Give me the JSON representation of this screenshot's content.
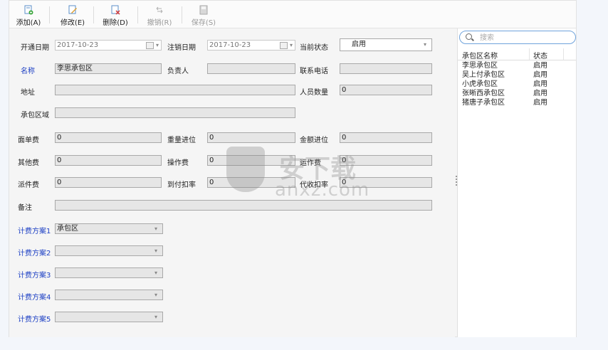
{
  "toolbar": {
    "add": "添加(A)",
    "edit": "修改(E)",
    "delete": "删除(D)",
    "undo": "撤销(R)",
    "save": "保存(S)"
  },
  "form": {
    "open_date": {
      "label": "开通日期",
      "value": "2017-10-23"
    },
    "cancel_date": {
      "label": "注销日期",
      "value": "2017-10-23"
    },
    "status": {
      "label": "当前状态",
      "value": "启用"
    },
    "name": {
      "label": "名称",
      "value": "李思承包区"
    },
    "manager": {
      "label": "负责人",
      "value": ""
    },
    "phone": {
      "label": "联系电话",
      "value": ""
    },
    "address": {
      "label": "地址",
      "value": ""
    },
    "staff_count": {
      "label": "人员数量",
      "value": "0"
    },
    "region": {
      "label": "承包区域",
      "value": ""
    },
    "sheet_fee": {
      "label": "面单费",
      "value": "0"
    },
    "weight_round": {
      "label": "重量进位",
      "value": "0"
    },
    "amount_round": {
      "label": "金额进位",
      "value": "0"
    },
    "other_fee": {
      "label": "其他费",
      "value": "0"
    },
    "operation_fee": {
      "label": "操作费",
      "value": "0"
    },
    "freight": {
      "label": "运作费",
      "value": "0"
    },
    "delivery_fee": {
      "label": "派件费",
      "value": "0"
    },
    "cod_deduct": {
      "label": "到付扣率",
      "value": "0"
    },
    "collect_deduct": {
      "label": "代收扣率",
      "value": "0"
    },
    "remark": {
      "label": "备注",
      "value": ""
    },
    "plans": [
      {
        "label": "计费方案1",
        "value": "承包区"
      },
      {
        "label": "计费方案2",
        "value": ""
      },
      {
        "label": "计费方案3",
        "value": ""
      },
      {
        "label": "计费方案4",
        "value": ""
      },
      {
        "label": "计费方案5",
        "value": ""
      }
    ]
  },
  "list": {
    "search_placeholder": "搜索",
    "col_name": "承包区名称",
    "col_status": "状态",
    "rows": [
      {
        "name": "李思承包区",
        "status": "启用"
      },
      {
        "name": "吴上付承包区",
        "status": "启用"
      },
      {
        "name": "小虎承包区",
        "status": "启用"
      },
      {
        "name": "张晰西承包区",
        "status": "启用"
      },
      {
        "name": "猪唐子承包区",
        "status": "启用"
      }
    ]
  },
  "watermark": {
    "cn": "安下载",
    "en": "anxz.com"
  },
  "colors": {
    "accent": "#1c3fc4",
    "search_border": "#6fa3dc"
  }
}
